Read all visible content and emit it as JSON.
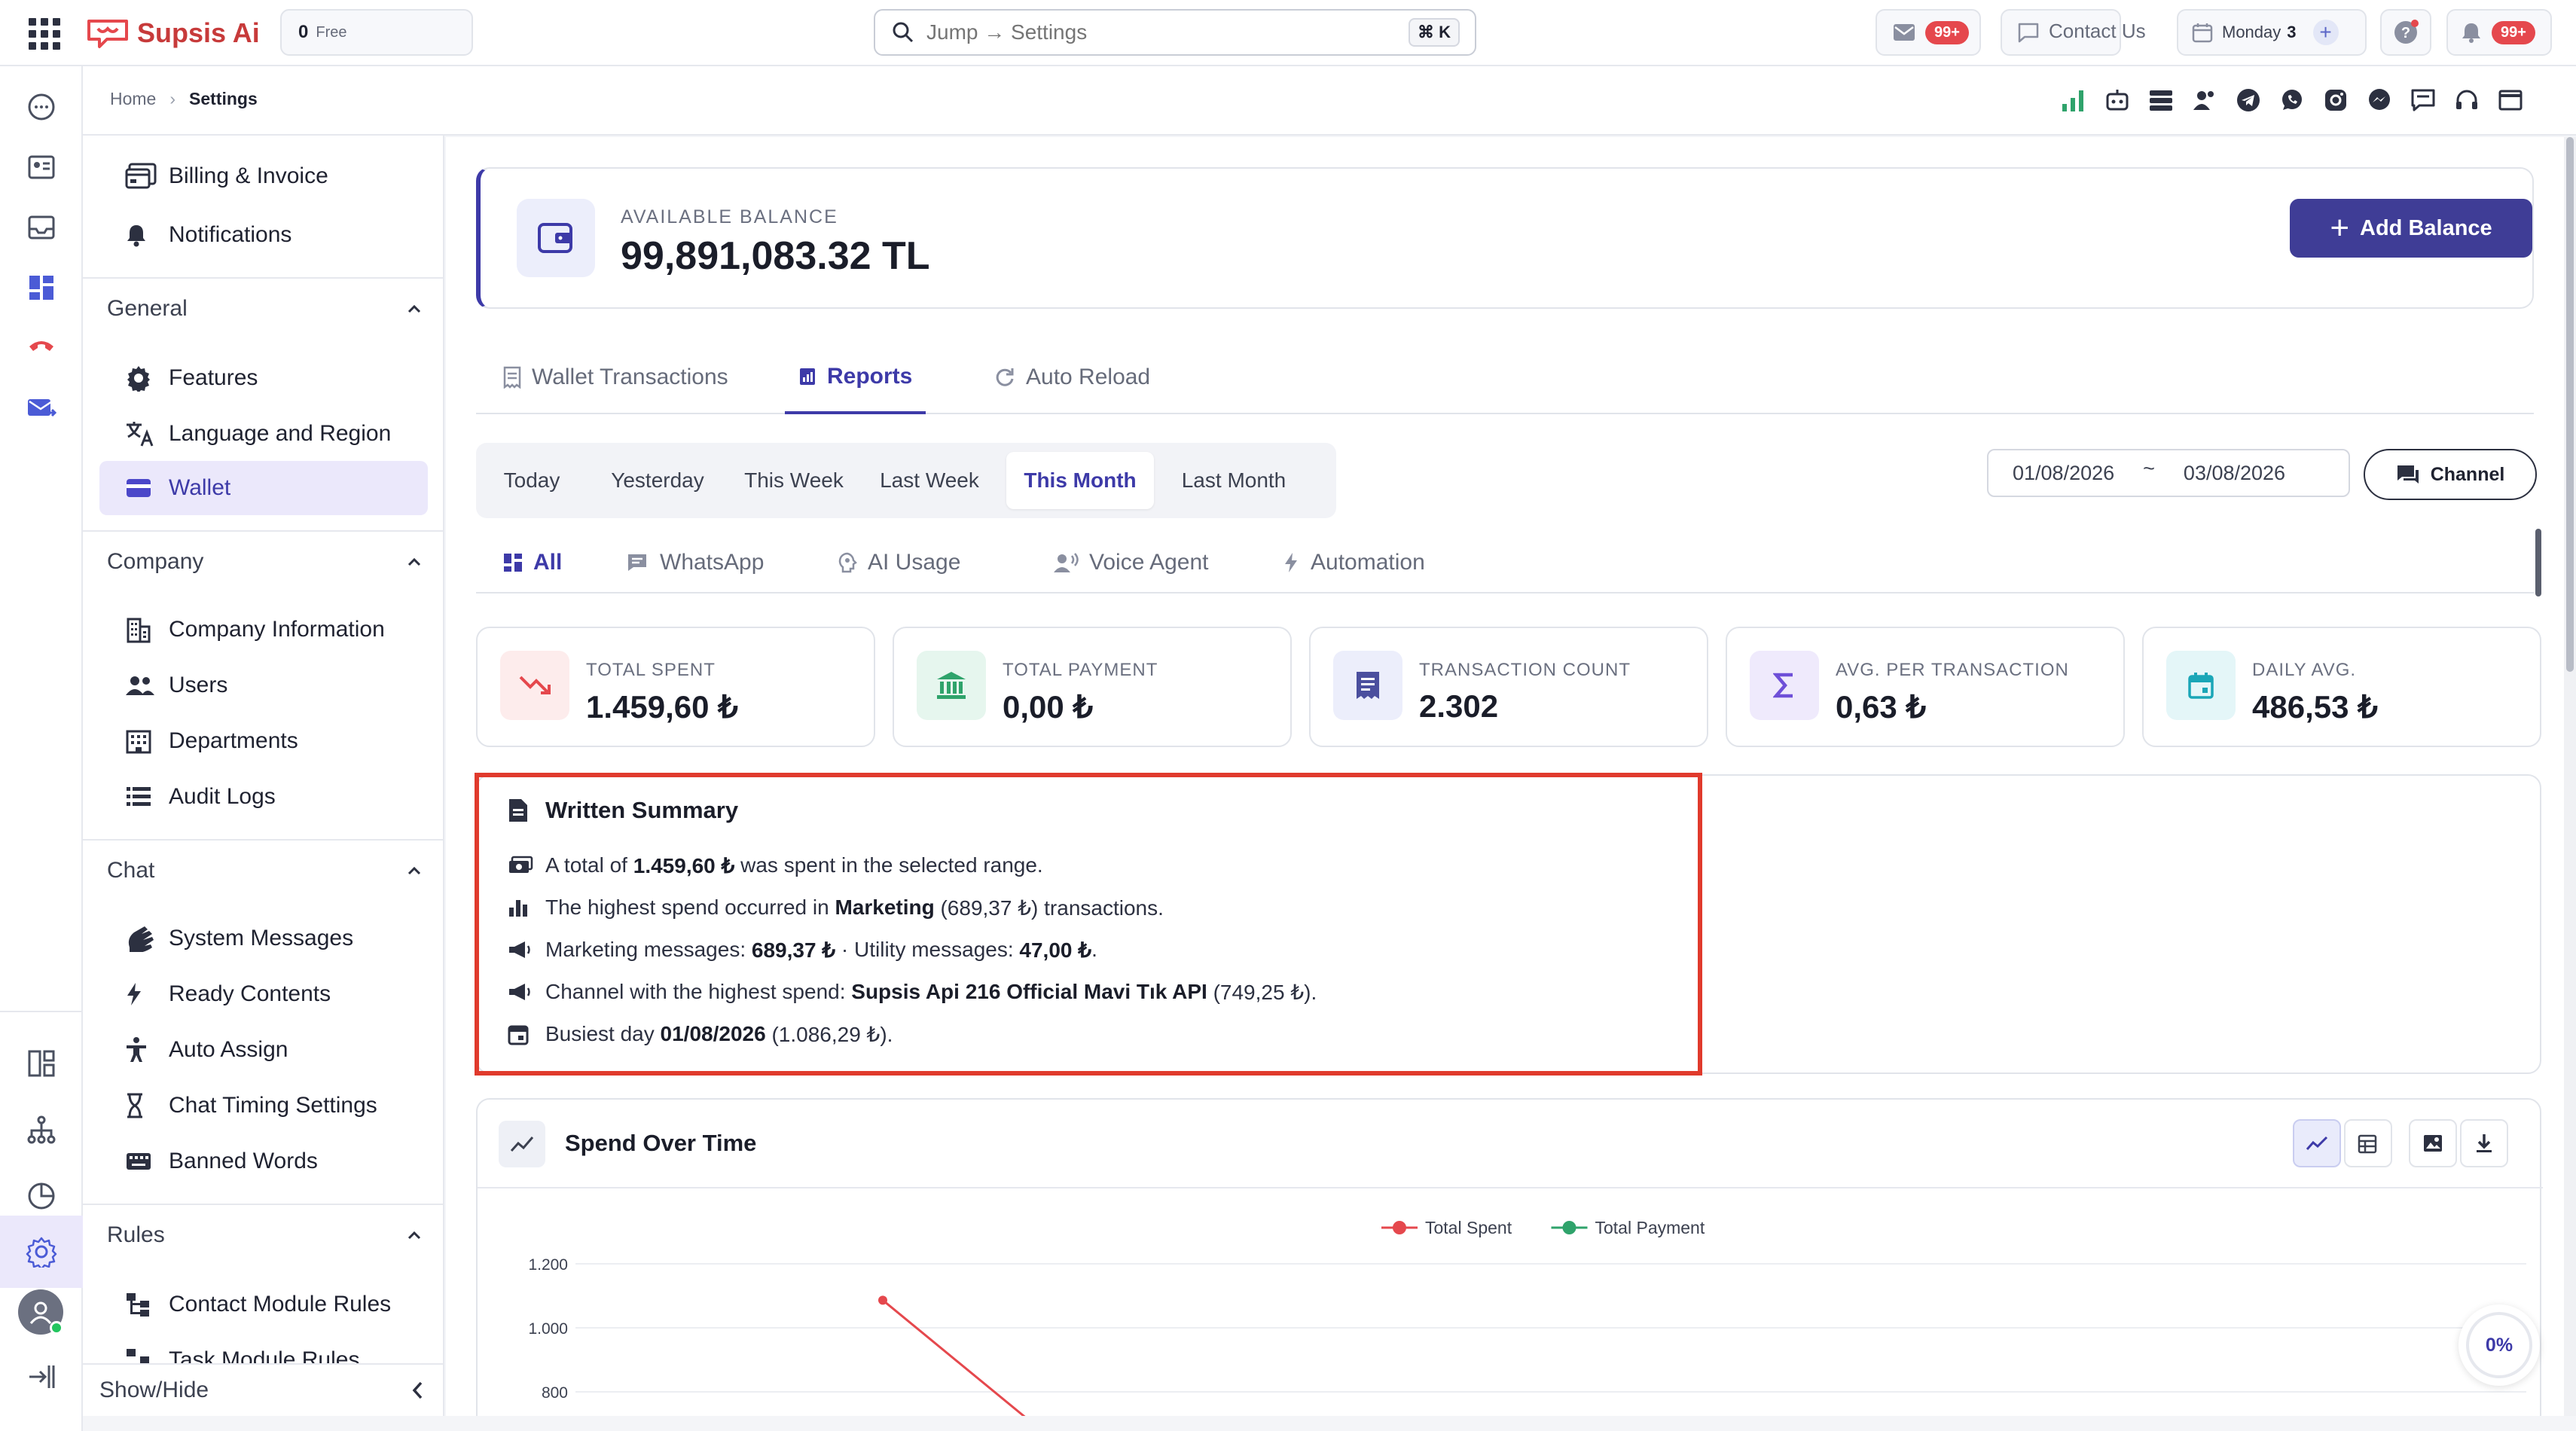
{
  "brand": {
    "name": "Supsis Ai"
  },
  "topbar": {
    "credit_value": "0",
    "credit_label": "Free",
    "search_placeholder": "Jump → Settings",
    "search_shortcut": "⌘ K",
    "mail_badge": "99+",
    "contact_label": "Contact Us",
    "calendar_day": "Monday",
    "calendar_count": "3",
    "notif_badge": "99+"
  },
  "breadcrumb": {
    "home": "Home",
    "current": "Settings"
  },
  "sidebar": {
    "top_items": [
      {
        "label": "Billing & Invoice",
        "icon": "billing-icon"
      },
      {
        "label": "Notifications",
        "icon": "bell-icon"
      }
    ],
    "sections": [
      {
        "title": "General",
        "items": [
          {
            "label": "Features",
            "icon": "gear-icon"
          },
          {
            "label": "Language and Region",
            "icon": "translate-icon"
          },
          {
            "label": "Wallet",
            "icon": "wallet-icon",
            "active": true
          }
        ]
      },
      {
        "title": "Company",
        "items": [
          {
            "label": "Company Information",
            "icon": "building-icon"
          },
          {
            "label": "Users",
            "icon": "users-icon"
          },
          {
            "label": "Departments",
            "icon": "departments-icon"
          },
          {
            "label": "Audit Logs",
            "icon": "list-icon"
          }
        ]
      },
      {
        "title": "Chat",
        "items": [
          {
            "label": "System Messages",
            "icon": "wave-icon"
          },
          {
            "label": "Ready Contents",
            "icon": "bolt-icon"
          },
          {
            "label": "Auto Assign",
            "icon": "person-icon"
          },
          {
            "label": "Chat Timing Settings",
            "icon": "hourglass-icon"
          },
          {
            "label": "Banned Words",
            "icon": "keyboard-icon"
          }
        ]
      },
      {
        "title": "Rules",
        "items": [
          {
            "label": "Contact Module Rules",
            "icon": "rules-icon"
          },
          {
            "label": "Task Module Rules",
            "icon": "rules-icon"
          }
        ]
      }
    ],
    "footer_label": "Show/Hide"
  },
  "balance": {
    "label": "AVAILABLE BALANCE",
    "amount": "99,891,083.32 TL",
    "add_button": "Add Balance"
  },
  "tabs": [
    {
      "label": "Wallet Transactions",
      "icon": "receipt-icon"
    },
    {
      "label": "Reports",
      "icon": "report-icon",
      "active": true
    },
    {
      "label": "Auto Reload",
      "icon": "reload-icon"
    }
  ],
  "periods": [
    "Today",
    "Yesterday",
    "This Week",
    "Last Week",
    "This Month",
    "Last Month"
  ],
  "active_period": "This Month",
  "date_range": {
    "from": "01/08/2026",
    "sep": "~",
    "to": "03/08/2026"
  },
  "channel_button": "Channel",
  "filter_tabs": [
    {
      "label": "All",
      "icon": "grid-icon",
      "active": true
    },
    {
      "label": "WhatsApp",
      "icon": "chat-icon"
    },
    {
      "label": "AI Usage",
      "icon": "ai-icon"
    },
    {
      "label": "Voice Agent",
      "icon": "voice-icon"
    },
    {
      "label": "Automation",
      "icon": "bolt-icon"
    }
  ],
  "stats": [
    {
      "label": "TOTAL SPENT",
      "value": "1.459,60 ₺",
      "icon": "trend-down-icon",
      "color": "#e5484d",
      "bg": "#fdecec"
    },
    {
      "label": "TOTAL PAYMENT",
      "value": "0,00 ₺",
      "icon": "bank-icon",
      "color": "#2fa36b",
      "bg": "#e6f6ee"
    },
    {
      "label": "TRANSACTION COUNT",
      "value": "2.302",
      "icon": "receipt-icon",
      "color": "#4b4f9e",
      "bg": "#eceefb"
    },
    {
      "label": "AVG. PER TRANSACTION",
      "value": "0,63 ₺",
      "icon": "sigma-icon",
      "color": "#6e4fd8",
      "bg": "#efeafc"
    },
    {
      "label": "DAILY AVG.",
      "value": "486,53 ₺",
      "icon": "calendar-icon",
      "color": "#1aa6b7",
      "bg": "#e4f6f8"
    }
  ],
  "summary": {
    "title": "Written Summary",
    "l1_a": "A total of ",
    "l1_b": "1.459,60 ₺",
    "l1_c": " was spent in the selected range.",
    "l2_a": "The highest spend occurred in ",
    "l2_b": "Marketing",
    "l2_c": " (689,37 ₺) transactions.",
    "l3_a": "Marketing messages: ",
    "l3_b": "689,37 ₺",
    "l3_c": " · Utility messages: ",
    "l3_d": "47,00 ₺",
    "l3_e": ".",
    "l4_a": "Channel with the highest spend: ",
    "l4_b": "Supsis Api 216 Official Mavi Tık API",
    "l4_c": " (749,25 ₺).",
    "l5_a": "Busiest day ",
    "l5_b": "01/08/2026",
    "l5_c": " (1.086,29 ₺)."
  },
  "chart_panel": {
    "title": "Spend Over Time"
  },
  "progress": {
    "label": "0%",
    "value": 0
  },
  "chart_data": {
    "type": "line",
    "title": "",
    "xlabel": "",
    "ylabel": "",
    "y_ticks": [
      "1.200",
      "1.000",
      "800"
    ],
    "ylim": [
      800,
      1200
    ],
    "series": [
      {
        "name": "Total Spent",
        "color": "#e5484d",
        "x": [
          "01/08/2026"
        ],
        "values": [
          1086.29
        ]
      },
      {
        "name": "Total Payment",
        "color": "#2fa36b",
        "x": [],
        "values": []
      }
    ],
    "legend": "top-center",
    "grid": true
  }
}
